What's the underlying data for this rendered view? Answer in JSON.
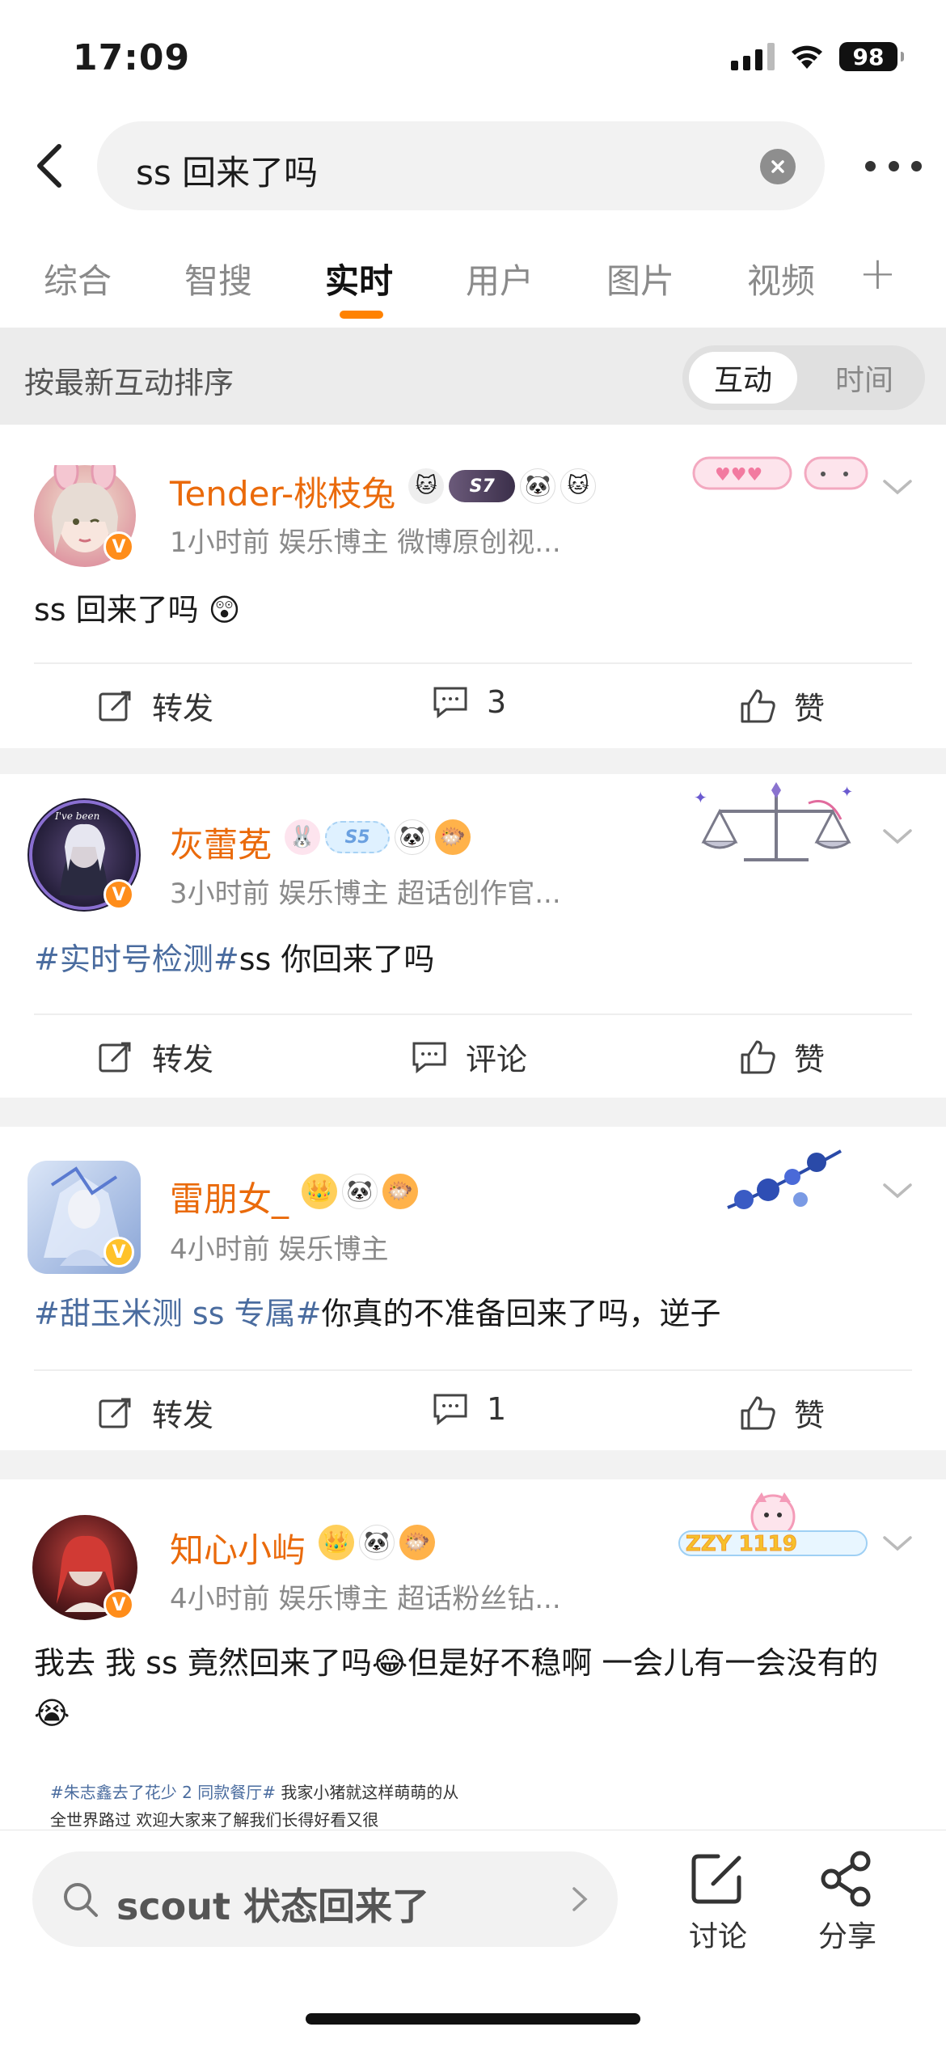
{
  "status_bar": {
    "time": "17:09",
    "battery": "98"
  },
  "search": {
    "query": "ss 回来了吗"
  },
  "tabs": [
    {
      "label": "综合"
    },
    {
      "label": "智搜"
    },
    {
      "label": "实时"
    },
    {
      "label": "用户"
    },
    {
      "label": "图片"
    },
    {
      "label": "视频"
    }
  ],
  "active_tab": "实时",
  "sort": {
    "label": "按最新互动排序",
    "options": [
      "互动",
      "时间"
    ],
    "selected": "互动"
  },
  "posts": [
    {
      "username": "Tender-桃枝兔",
      "level_badge": "S7",
      "meta": "1小时前  娱乐博主 微博原创视...",
      "text_plain": "ss 回来了吗",
      "repost_label": "转发",
      "comment_label": "3",
      "like_label": "赞"
    },
    {
      "username": "灰蕾莬",
      "level_badge": "S5",
      "meta": "3小时前  娱乐博主 超话创作官...",
      "hashtag": "#实时号检测#",
      "text_plain": "ss 你回来了吗",
      "repost_label": "转发",
      "comment_label": "评论",
      "like_label": "赞"
    },
    {
      "username": "雷朋女_",
      "meta": "4小时前  娱乐博主",
      "hashtag": "#甜玉米测 ss 专属#",
      "text_plain": "你真的不准备回来了吗，逆子",
      "repost_label": "转发",
      "comment_label": "1",
      "like_label": "赞"
    },
    {
      "username": "知心小屿",
      "deco_text": "ZZY 1119",
      "meta": "4小时前  娱乐博主 超话粉丝钻...",
      "text_plain": "我去 我 ss 竟然回来了吗😂但是好不稳啊 一会儿有一会没有的😭",
      "preview_hashtag": "#朱志鑫去了花少 2 同款餐厅#",
      "preview_text": " 我家小猪就这样萌萌的从全世界路过 欢迎大家来了解我们长得好看又很"
    }
  ],
  "bottom_bar": {
    "search_suggestion": "scout 状态回来了",
    "discuss_label": "讨论",
    "share_label": "分享"
  },
  "colors": {
    "accent": "#ff8200",
    "username": "#ea6a0b",
    "hashtag": "#4a6c9f"
  }
}
